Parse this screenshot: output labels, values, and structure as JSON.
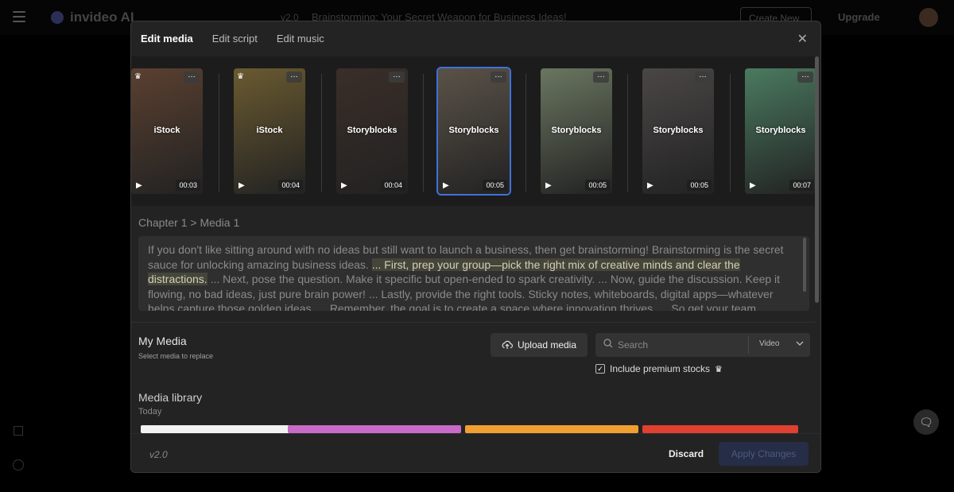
{
  "app": {
    "logo_text": "invideo AI",
    "version_badge": "v2.0",
    "project_title": "Brainstorming: Your Secret Weapon for Business Ideas!",
    "create_new_label": "Create New",
    "upgrade_label": "Upgrade"
  },
  "modal": {
    "tabs": [
      {
        "label": "Edit media",
        "active": true
      },
      {
        "label": "Edit script",
        "active": false
      },
      {
        "label": "Edit music",
        "active": false
      }
    ],
    "close_icon": "close-icon"
  },
  "clips": [
    {
      "source": "iStock",
      "duration": "00:03",
      "premium": true,
      "selected": false,
      "bg": "#5a4030"
    },
    {
      "source": "iStock",
      "duration": "00:04",
      "premium": true,
      "selected": false,
      "bg": "#6a5a30"
    },
    {
      "source": "Storyblocks",
      "duration": "00:04",
      "premium": false,
      "selected": false,
      "bg": "#3a2e28"
    },
    {
      "source": "Storyblocks",
      "duration": "00:05",
      "premium": false,
      "selected": true,
      "bg": "#5a5248"
    },
    {
      "source": "Storyblocks",
      "duration": "00:05",
      "premium": false,
      "selected": false,
      "bg": "#6a7660"
    },
    {
      "source": "Storyblocks",
      "duration": "00:05",
      "premium": false,
      "selected": false,
      "bg": "#4a4646"
    },
    {
      "source": "Storyblocks",
      "duration": "00:07",
      "premium": false,
      "selected": false,
      "bg": "#4a7a60"
    }
  ],
  "breadcrumb": "Chapter 1 > Media 1",
  "script": {
    "before": "If you don't like sitting around with no ideas but still want to launch a business, then get brainstorming! Brainstorming is the secret sauce for unlocking amazing business ideas. ",
    "highlight": "... First, prep your group—pick the right mix of creative minds and clear the distractions.",
    "after": " ... Next, pose the question. Make it specific but open-ended to spark creativity. ... Now, guide the discussion. Keep it flowing, no bad ideas, just pure brain power! ... Lastly, provide the right tools. Sticky notes, whiteboards, digital apps—whatever helps capture those golden ideas. ... Remember, the goal is to create a space where innovation thrives. ... So get your team"
  },
  "my_media": {
    "title": "My Media",
    "subtitle": "Select media to replace",
    "upload_label": "Upload media",
    "search_placeholder": "Search",
    "media_type": "Video",
    "premium_label": "Include premium stocks",
    "premium_checked": true
  },
  "library": {
    "title": "Media library",
    "date_group": "Today",
    "thumb_colors": [
      "#f2f2f2",
      "#c86ac8",
      "#f0a030",
      "#e04030"
    ]
  },
  "footer": {
    "version": "v2.0",
    "discard_label": "Discard",
    "apply_label": "Apply Changes"
  }
}
